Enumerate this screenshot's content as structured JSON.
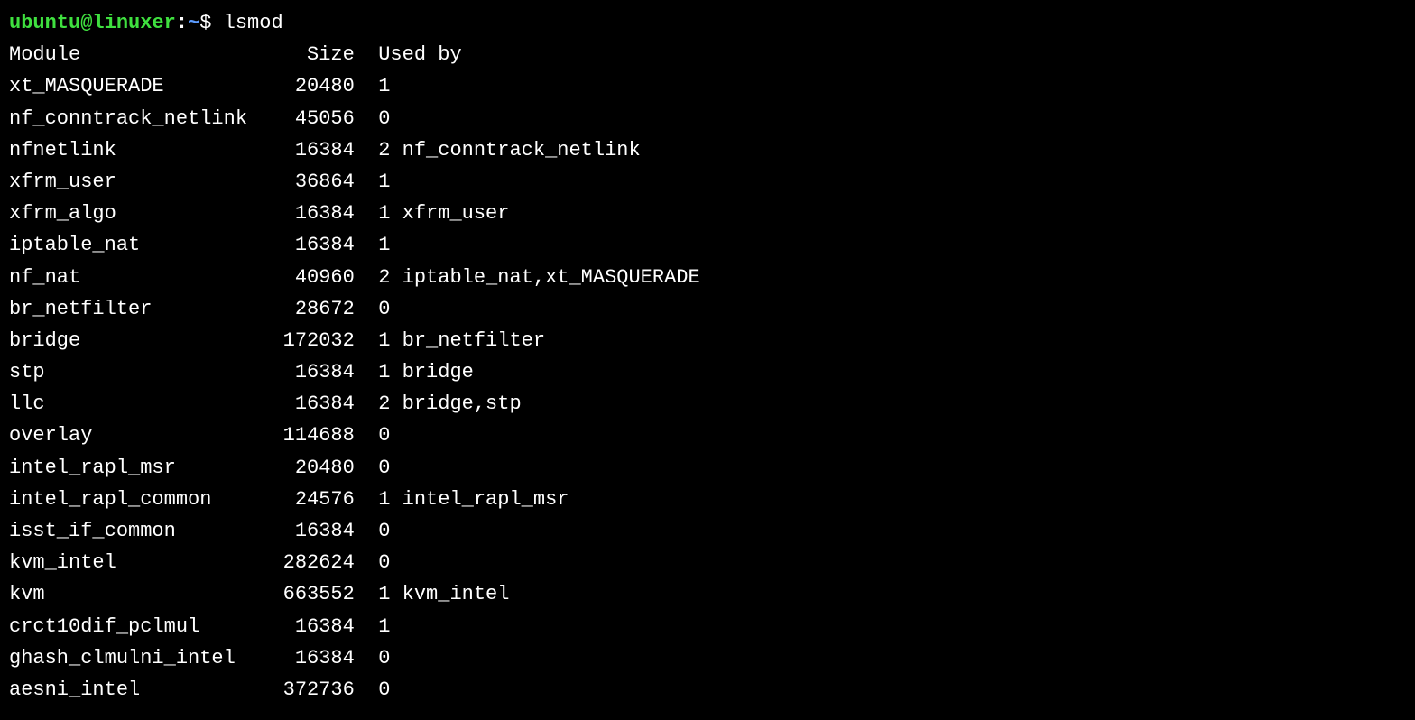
{
  "prompt": {
    "user_host": "ubuntu@linuxer",
    "colon": ":",
    "path": "~",
    "dollar": "$",
    "command": "lsmod"
  },
  "header": {
    "module": "Module",
    "size": "Size",
    "used_by": "Used by"
  },
  "rows": [
    {
      "module": "xt_MASQUERADE",
      "size": "20480",
      "used": "1"
    },
    {
      "module": "nf_conntrack_netlink",
      "size": "45056",
      "used": "0"
    },
    {
      "module": "nfnetlink",
      "size": "16384",
      "used": "2 nf_conntrack_netlink"
    },
    {
      "module": "xfrm_user",
      "size": "36864",
      "used": "1"
    },
    {
      "module": "xfrm_algo",
      "size": "16384",
      "used": "1 xfrm_user"
    },
    {
      "module": "iptable_nat",
      "size": "16384",
      "used": "1"
    },
    {
      "module": "nf_nat",
      "size": "40960",
      "used": "2 iptable_nat,xt_MASQUERADE"
    },
    {
      "module": "br_netfilter",
      "size": "28672",
      "used": "0"
    },
    {
      "module": "bridge",
      "size": "172032",
      "used": "1 br_netfilter"
    },
    {
      "module": "stp",
      "size": "16384",
      "used": "1 bridge"
    },
    {
      "module": "llc",
      "size": "16384",
      "used": "2 bridge,stp"
    },
    {
      "module": "overlay",
      "size": "114688",
      "used": "0"
    },
    {
      "module": "intel_rapl_msr",
      "size": "20480",
      "used": "0"
    },
    {
      "module": "intel_rapl_common",
      "size": "24576",
      "used": "1 intel_rapl_msr"
    },
    {
      "module": "isst_if_common",
      "size": "16384",
      "used": "0"
    },
    {
      "module": "kvm_intel",
      "size": "282624",
      "used": "0"
    },
    {
      "module": "kvm",
      "size": "663552",
      "used": "1 kvm_intel"
    },
    {
      "module": "crct10dif_pclmul",
      "size": "16384",
      "used": "1"
    },
    {
      "module": "ghash_clmulni_intel",
      "size": "16384",
      "used": "0"
    },
    {
      "module": "aesni_intel",
      "size": "372736",
      "used": "0"
    }
  ]
}
